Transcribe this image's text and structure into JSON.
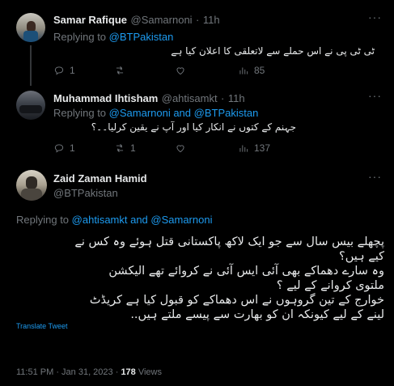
{
  "tweets": [
    {
      "name": "Samar Rafique",
      "handle": "@Samarnoni",
      "time": "11h",
      "replying_prefix": "Replying to ",
      "replying_to": "@BTPakistan",
      "text": "ٹی ٹی پی نے اس حملے سے لاتعلقی کا اعلان کیا ہے",
      "replies": "1",
      "retweets": "",
      "likes": "",
      "views": "85"
    },
    {
      "name": "Muhammad Ihtisham",
      "handle": "@ahtisamkt",
      "time": "11h",
      "replying_prefix": "Replying to ",
      "replying_to": "@Samarnoni and @BTPakistan",
      "text": "جہنم کے کتوں نے انکار کیا اور آپ نے یقین کرلیا۔۔؟",
      "replies": "1",
      "retweets": "1",
      "likes": "",
      "views": "137"
    }
  ],
  "main": {
    "name": "Zaid Zaman Hamid",
    "handle": "@BTPakistan",
    "replying_prefix": "Replying to ",
    "replying_to": "@ahtisamkt and @Samarnoni",
    "lines": [
      "پچھلے بیس سال سے جو ایک لاکھ پاکستانی قتل ہوئے وہ کس نے",
      "کیے ہیں؟",
      "وہ سارے دھماکے بھی آئی ایس آئی نے کروائے تھے الیکشن",
      "ملتوی کروانے کے لیے ؟",
      "خوارج کے تین گروہوں نے اس دھماکے کو قبول کیا ہے کریڈٹ",
      "لینے کے لیے کیونکہ ان کو بھارت سے پیسے ملتے ہیں.."
    ],
    "translate": "Translate Tweet",
    "timestamp": "11:51 PM · Jan 31, 2023 · ",
    "views_count": "178",
    "views_label": " Views"
  },
  "icons": [
    "reply-icon",
    "retweet-icon",
    "like-icon",
    "views-icon",
    "more-icon"
  ]
}
